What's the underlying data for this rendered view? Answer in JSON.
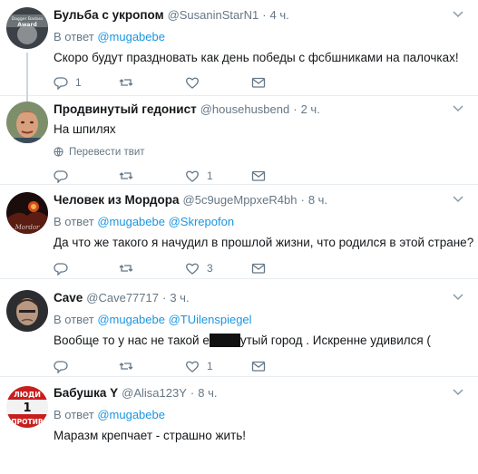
{
  "tweets": [
    {
      "name": "Бульба с укропом",
      "handle": "@SusaninStarN1",
      "dot": "·",
      "time": "4 ч.",
      "reply_prefix": "В ответ",
      "reply_to": [
        "@mugabebe"
      ],
      "text": "Скоро будут праздновать как день победы с фсбшниками на палочках!",
      "avatar_label_1": "Dagger Badass",
      "avatar_label_2": "Award",
      "reply_count": "1",
      "retweet_count": "",
      "like_count": "",
      "icons": [
        "reply-icon",
        "retweet-icon",
        "like-icon",
        "message-icon"
      ]
    },
    {
      "name": "Продвинутый гедонист",
      "handle": "@househusbend",
      "dot": "·",
      "time": "2 ч.",
      "text": "На шпилях",
      "translate": "Перевести твит",
      "reply_count": "",
      "retweet_count": "",
      "like_count": "1"
    },
    {
      "name": "Человек из Мордора",
      "handle": "@5c9ugeMppxeR4bh",
      "dot": "·",
      "time": "8 ч.",
      "reply_prefix": "В ответ",
      "reply_to": [
        "@mugabebe",
        "@Skrepofon"
      ],
      "text": "Да что же такого я начудил в прошлой жизни, что родился в этой стране?",
      "avatar_label": "Mordor",
      "reply_count": "",
      "retweet_count": "",
      "like_count": "3"
    },
    {
      "name": "Cave",
      "handle": "@Cave77717",
      "dot": "·",
      "time": "3 ч.",
      "reply_prefix": "В ответ",
      "reply_to": [
        "@mugabebe",
        "@TUilenspiegel"
      ],
      "text_before": "Вообще то у нас не такой е",
      "text_after": "утый город . Искренне удивился (",
      "reply_count": "",
      "retweet_count": "",
      "like_count": "1"
    },
    {
      "name": "Бабушка Y",
      "handle": "@Alisa123Y",
      "dot": "·",
      "time": "8 ч.",
      "reply_prefix": "В ответ",
      "reply_to": [
        "@mugabebe"
      ],
      "text": "Маразм крепчает - страшно жить!",
      "avatar_line_1": "ЛЮДИ",
      "avatar_line_2": "1",
      "avatar_line_3": "ПРОТИВ"
    }
  ],
  "colors": {
    "text": "#14171a",
    "secondary": "#657786",
    "link": "#1b95e0",
    "divider": "#e6ecf0",
    "thread_line": "#ccd6dd"
  }
}
